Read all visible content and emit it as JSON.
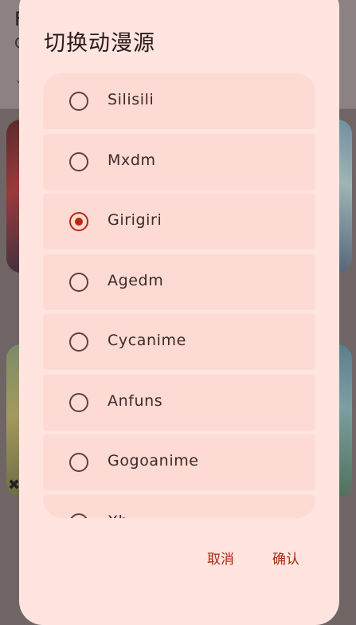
{
  "background": {
    "title": "F",
    "subtitle": "C",
    "tick": "˅",
    "close_glyph": "✖"
  },
  "dialog": {
    "title": "切换动漫源",
    "selected_index": 2,
    "options": [
      {
        "label": "Silisili",
        "selected": false
      },
      {
        "label": "Mxdm",
        "selected": false
      },
      {
        "label": "Girigiri",
        "selected": true
      },
      {
        "label": "Agedm",
        "selected": false
      },
      {
        "label": "Cycanime",
        "selected": false
      },
      {
        "label": "Anfuns",
        "selected": false
      },
      {
        "label": "Gogoanime",
        "selected": false
      },
      {
        "label": "Xb",
        "selected": false
      }
    ],
    "cancel_label": "取消",
    "confirm_label": "确认"
  },
  "colors": {
    "dialog_bg": "#ffe4df",
    "option_bg": "#fddad3",
    "accent": "#b72a10",
    "text": "#3a2b29"
  }
}
